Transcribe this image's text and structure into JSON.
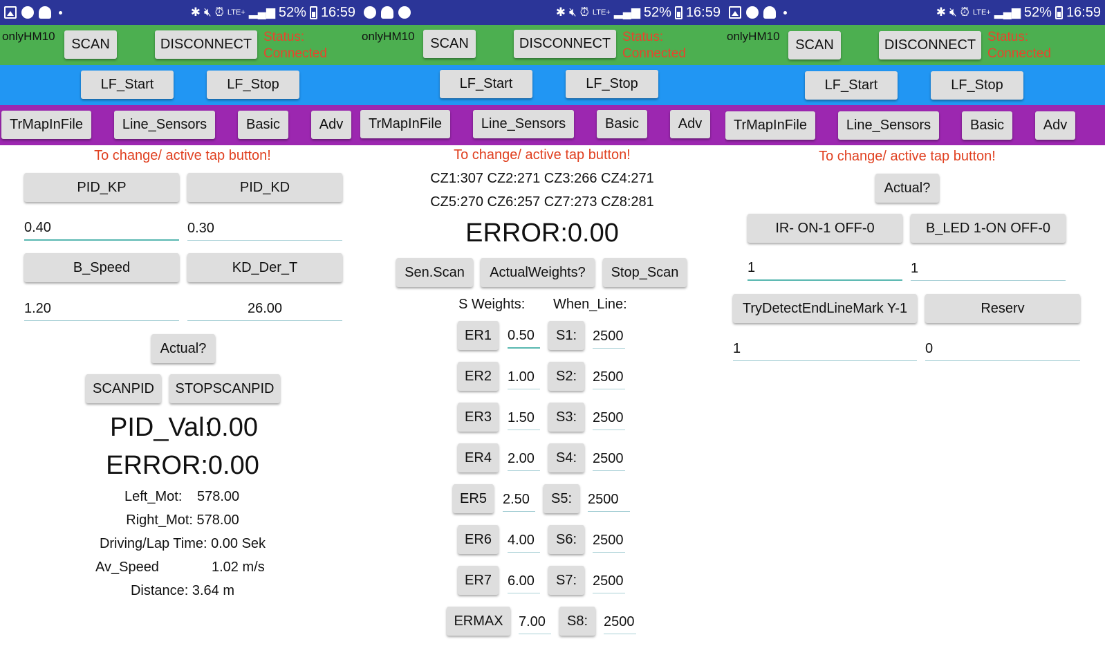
{
  "status_bar": {
    "battery": "52%",
    "time": "16:59",
    "network": "LTE+"
  },
  "screens": [
    {
      "device_name": "onlyHM10",
      "scan_label": "SCAN",
      "disconnect_label": "DISCONNECT",
      "status_line1": "Status:",
      "status_line2": "Connected",
      "lf_start": "LF_Start",
      "lf_stop": "LF_Stop",
      "tabs": [
        "TrMapInFile",
        "Line_Sensors",
        "Basic",
        "Adv"
      ],
      "hint": "To change/ active tap button!",
      "pid_kp": "PID_KP",
      "pid_kd": "PID_KD",
      "pid_kp_value": "0.40",
      "pid_kd_value": "0.30",
      "b_speed": "B_Speed",
      "kd_der_t": "KD_Der_T",
      "b_speed_value": "1.20",
      "kd_der_t_value": "26.00",
      "actual": "Actual?",
      "scanpid": "SCANPID",
      "stopscanpid": "STOPSCANPID",
      "pid_val_label": "PID_Val:",
      "pid_val": "0.00",
      "error": "ERROR:0.00",
      "left_mot_label": "Left_Mot:",
      "left_mot_value": "578.00",
      "right_mot": "Right_Mot: 578.00",
      "lap_time": "Driving/Lap Time: 0.00 Sek",
      "av_speed_label": "Av_Speed",
      "av_speed_value": "1.02 m/s",
      "distance": "Distance: 3.64 m"
    },
    {
      "device_name": "onlyHM10",
      "scan_label": "SCAN",
      "disconnect_label": "DISCONNECT",
      "status_line1": "Status:",
      "status_line2": "Connected",
      "lf_start": "LF_Start",
      "lf_stop": "LF_Stop",
      "tabs": [
        "TrMapInFile",
        "Line_Sensors",
        "Basic",
        "Adv"
      ],
      "hint": "To change/ active tap button!",
      "cz_line1": "CZ1:307 CZ2:271 CZ3:266 CZ4:271",
      "cz_line2": "CZ5:270 CZ6:257 CZ7:273 CZ8:281",
      "error": "ERROR:0.00",
      "sen_scan": "Sen.Scan",
      "actual_weights": "ActualWeights?",
      "stop_scan": "Stop_Scan",
      "s_weights": "S Weights:",
      "when_line": "When_Line:",
      "rows": [
        {
          "er": "ER1",
          "er_value": "0.50",
          "s": "S1:",
          "s_value": "2500"
        },
        {
          "er": "ER2",
          "er_value": "1.00",
          "s": "S2:",
          "s_value": "2500"
        },
        {
          "er": "ER3",
          "er_value": "1.50",
          "s": "S3:",
          "s_value": "2500"
        },
        {
          "er": "ER4",
          "er_value": "2.00",
          "s": "S4:",
          "s_value": "2500"
        },
        {
          "er": "ER5",
          "er_value": "2.50",
          "s": "S5:",
          "s_value": "2500"
        },
        {
          "er": "ER6",
          "er_value": "4.00",
          "s": "S6:",
          "s_value": "2500"
        },
        {
          "er": "ER7",
          "er_value": "6.00",
          "s": "S7:",
          "s_value": "2500"
        },
        {
          "er": "ERMAX",
          "er_value": "7.00",
          "s": "S8:",
          "s_value": "2500"
        }
      ]
    },
    {
      "device_name": "onlyHM10",
      "scan_label": "SCAN",
      "disconnect_label": "DISCONNECT",
      "status_line1": "Status:",
      "status_line2": "Connected",
      "lf_start": "LF_Start",
      "lf_stop": "LF_Stop",
      "tabs": [
        "TrMapInFile",
        "Line_Sensors",
        "Basic",
        "Adv"
      ],
      "hint": "To change/ active tap button!",
      "actual": "Actual?",
      "ir_label": "IR- ON-1 OFF-0",
      "bled_label": "B_LED 1-ON OFF-0",
      "ir_value": "1",
      "bled_value": "1",
      "try_detect": "TryDetectEndLineMark Y-1",
      "reserv": "Reserv",
      "try_detect_value": "1",
      "reserv_value": "0"
    }
  ],
  "colors": {
    "status_bar": "#2b3598",
    "header_green": "#4caf50",
    "lf_blue": "#2196f3",
    "tabs_purple": "#9c27b0",
    "status_red": "#e8442c",
    "hint_red": "#e04020",
    "field_underline": "#58b7b0"
  }
}
